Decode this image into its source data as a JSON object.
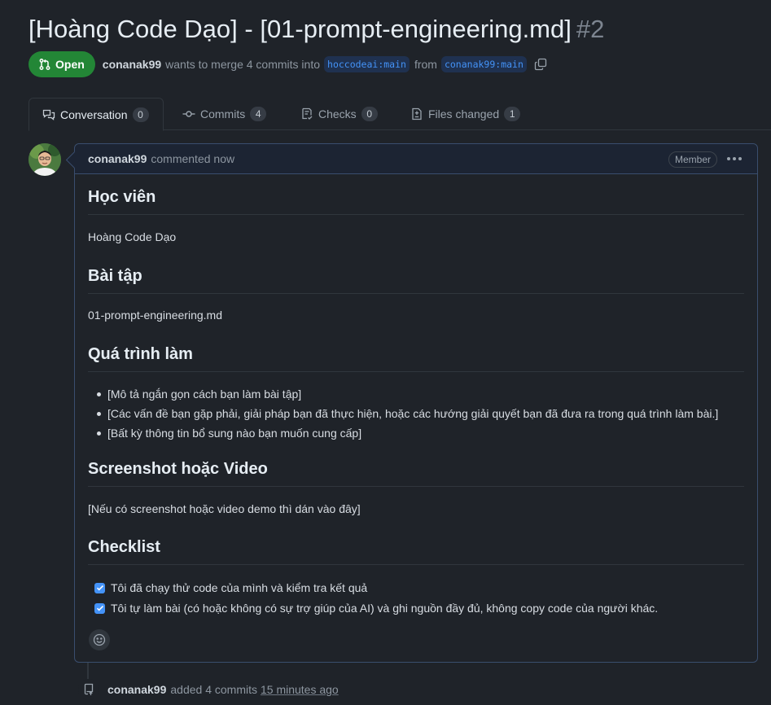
{
  "pr": {
    "title": "[Hoàng Code Dạo] - [01-prompt-engineering.md]",
    "number": "#2",
    "state": "Open",
    "author": "conanak99",
    "merge_text": "wants to merge 4 commits into",
    "base_branch": "hoccodeai:main",
    "from_text": "from",
    "head_branch": "conanak99:main"
  },
  "tabs": [
    {
      "label": "Conversation",
      "count": "0",
      "icon": "comment-discussion-icon",
      "active": true
    },
    {
      "label": "Commits",
      "count": "4",
      "icon": "git-commit-icon",
      "active": false
    },
    {
      "label": "Checks",
      "count": "0",
      "icon": "checklist-icon",
      "active": false
    },
    {
      "label": "Files changed",
      "count": "1",
      "icon": "file-diff-icon",
      "active": false
    }
  ],
  "comment": {
    "author": "conanak99",
    "action": "commented now",
    "role": "Member",
    "sections": {
      "student_heading": "Học viên",
      "student_name": "Hoàng Code Dạo",
      "exercise_heading": "Bài tập",
      "exercise_file": "01-prompt-engineering.md",
      "process_heading": "Quá trình làm",
      "process_items": [
        "[Mô tả ngắn gọn cách bạn làm bài tập]",
        "[Các vấn đề bạn gặp phải, giải pháp bạn đã thực hiện, hoặc các hướng giải quyết bạn đã đưa ra trong quá trình làm bài.]",
        "[Bất kỳ thông tin bổ sung nào bạn muốn cung cấp]"
      ],
      "screenshot_heading": "Screenshot hoặc Video",
      "screenshot_text": "[Nếu có screenshot hoặc video demo thì dán vào đây]",
      "checklist_heading": "Checklist",
      "checklist_items": [
        "Tôi đã chạy thử code của mình và kiểm tra kết quả",
        "Tôi tự làm bài (có hoặc không có sự trợ giúp của AI) và ghi nguồn đầy đủ, không copy code của người khác."
      ]
    }
  },
  "timeline": {
    "author": "conanak99",
    "action": "added 4 commits",
    "time": "15 minutes ago"
  },
  "colors": {
    "background": "#1f2329",
    "open_badge": "#238636",
    "link": "#4493f8",
    "comment_border": "#3a4e6e"
  }
}
